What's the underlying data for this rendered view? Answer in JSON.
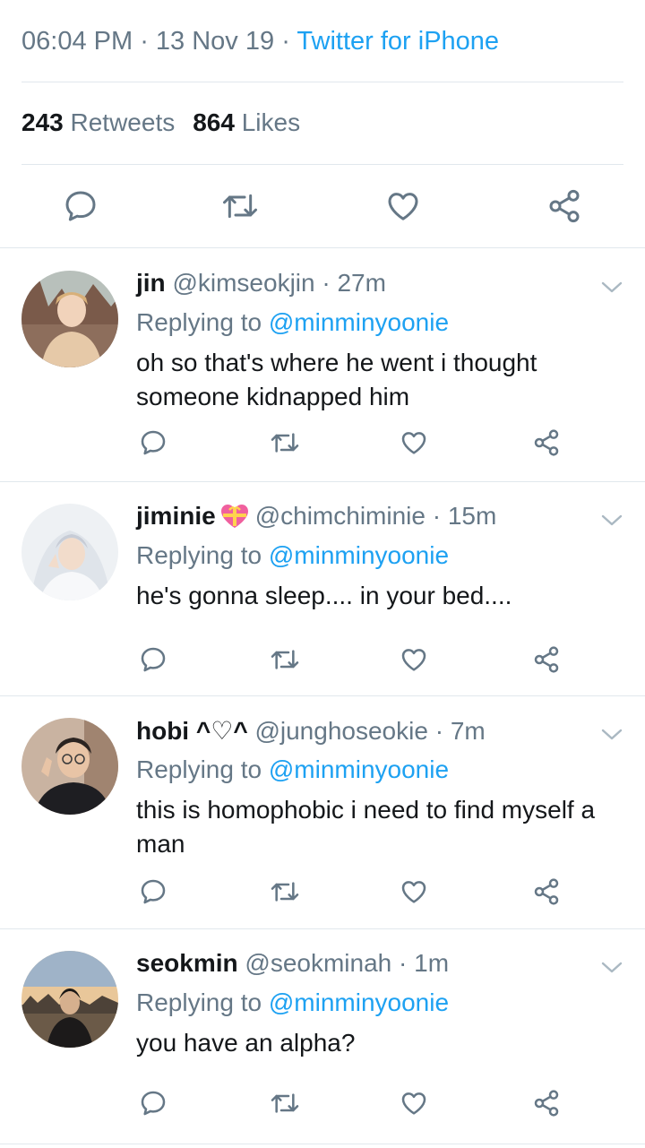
{
  "tweet": {
    "time": "06:04 PM",
    "date": "13 Nov 19",
    "source": "Twitter for iPhone",
    "retweets_count": "243",
    "retweets_label": "Retweets",
    "likes_count": "864",
    "likes_label": "Likes"
  },
  "colors": {
    "accent": "#1da1f2",
    "muted": "#657786",
    "text": "#14171a",
    "divider": "#e1e8ed"
  },
  "replies": [
    {
      "name": "jin",
      "handle": "@kimseokjin",
      "time": "27m",
      "replying_label": "Replying to",
      "mention": "@minminyoonie",
      "text": "oh so that's where he went i thought someone kidnapped him",
      "badge": ""
    },
    {
      "name": "jiminie",
      "handle": "@chimchiminie",
      "time": "15m",
      "replying_label": "Replying to",
      "mention": "@minminyoonie",
      "text": "he's gonna sleep.... in your bed....",
      "badge": "heart-gift-emoji"
    },
    {
      "name": "hobi ^♡^",
      "handle": "@junghoseokie",
      "time": "7m",
      "replying_label": "Replying to",
      "mention": "@minminyoonie",
      "text": "this is homophobic i need to find myself a man",
      "badge": ""
    },
    {
      "name": "seokmin",
      "handle": "@seokminah",
      "time": "1m",
      "replying_label": "Replying to",
      "mention": "@minminyoonie",
      "text": "you have an alpha?",
      "badge": ""
    }
  ],
  "icons": {
    "reply": "reply-icon",
    "retweet": "retweet-icon",
    "like": "heart-icon",
    "share": "share-icon",
    "menu": "chevron-down-icon"
  }
}
